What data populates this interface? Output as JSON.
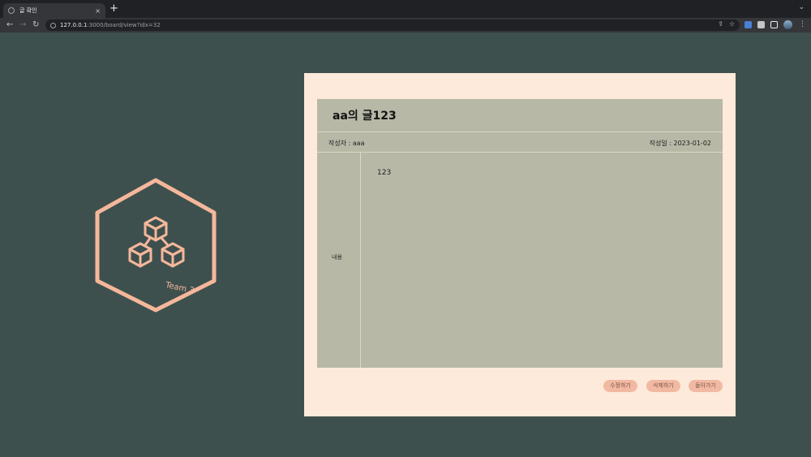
{
  "browser": {
    "tab_title": "글 확인",
    "tab_close": "×",
    "new_tab": "+",
    "tab_menu": "⌄",
    "url_host": "127.0.0.1",
    "url_path": ":3000/board/view?idx=32"
  },
  "logo": {
    "text": "Team 3"
  },
  "post": {
    "title": "aa의 글123",
    "author": "작성자 : aaa",
    "date": "작성일 : 2023-01-02",
    "content_label": "내용",
    "content": "123"
  },
  "actions": {
    "edit_label": "수정하기",
    "delete_label": "삭제하기",
    "back_label": "돌아가기"
  },
  "colors": {
    "background": "#3e504e",
    "card": "#fdeada",
    "panel": "#b7b8a6",
    "accent": "#f2b9a2"
  }
}
